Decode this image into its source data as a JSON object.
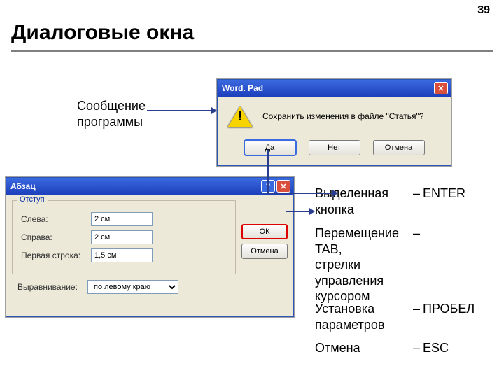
{
  "page": {
    "number": "39",
    "title": "Диалоговые окна"
  },
  "callout": {
    "program_message": "Сообщение\nпрограммы"
  },
  "msgbox": {
    "title": "Word. Pad",
    "text": "Сохранить изменения в файле \"Статья\"?",
    "buttons": {
      "yes": "Да",
      "no": "Нет",
      "cancel": "Отмена"
    }
  },
  "paragraph_dialog": {
    "title": "Абзац",
    "fieldset_legend": "Отступ",
    "left_label": "Слева:",
    "left_value": "2 см",
    "right_label": "Справа:",
    "right_value": "2 см",
    "firstline_label": "Первая строка:",
    "firstline_value": "1,5 см",
    "align_label": "Выравнивание:",
    "align_value": "по левому краю",
    "ok": "ОК",
    "cancel": "Отмена"
  },
  "info": {
    "highlighted_btn": "Выделенная кнопка",
    "highlighted_key": "ENTER",
    "move": "Перемещение",
    "move_key": "TAB,\nстрелки управления курсором",
    "set_params": "Установка параметров",
    "set_key": "ПРОБЕЛ",
    "cancel": "Отмена",
    "cancel_key": "ESC"
  }
}
